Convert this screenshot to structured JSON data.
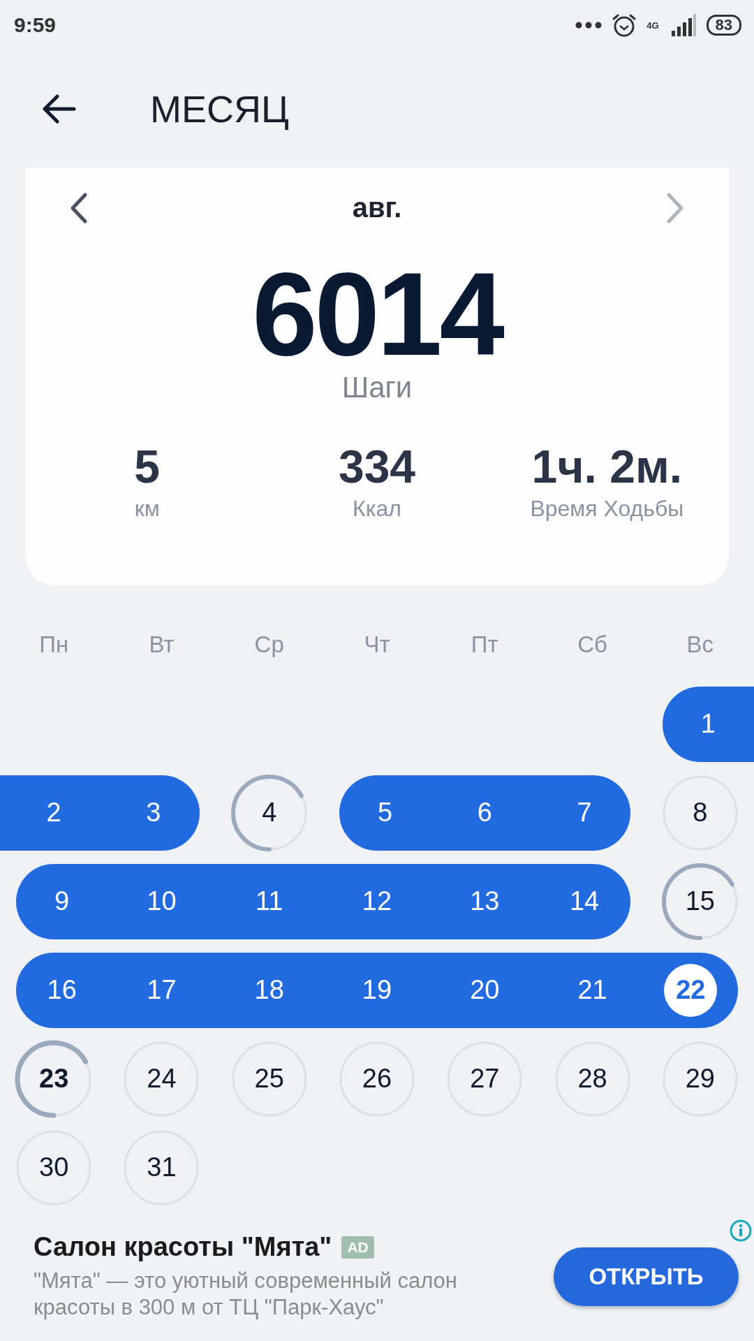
{
  "status_bar": {
    "time": "9:59",
    "network": "4G",
    "battery": "83"
  },
  "header": {
    "title": "МЕСЯЦ"
  },
  "summary": {
    "month": "авг.",
    "steps": "6014",
    "steps_label": "Шаги",
    "stats": [
      {
        "value": "5",
        "label": "км"
      },
      {
        "value": "334",
        "label": "Ккал"
      },
      {
        "value": "1ч. 2м.",
        "label": "Время Ходьбы"
      }
    ]
  },
  "calendar": {
    "weekdays": [
      "Пн",
      "Вт",
      "Ср",
      "Чт",
      "Пт",
      "Сб",
      "Вс"
    ],
    "weeks": [
      [
        {
          "day": "1",
          "kind": "goal",
          "selected": false,
          "today": false
        }
      ],
      [
        {
          "day": "2",
          "kind": "goal",
          "selected": false,
          "today": false
        },
        {
          "day": "3",
          "kind": "goal",
          "selected": false,
          "today": false
        },
        {
          "day": "4",
          "kind": "partial",
          "selected": false,
          "today": false
        },
        {
          "day": "5",
          "kind": "goal",
          "selected": false,
          "today": false
        },
        {
          "day": "6",
          "kind": "goal",
          "selected": false,
          "today": false
        },
        {
          "day": "7",
          "kind": "goal",
          "selected": false,
          "today": false
        },
        {
          "day": "8",
          "kind": "empty",
          "selected": false,
          "today": false
        }
      ],
      [
        {
          "day": "9",
          "kind": "goal",
          "selected": false,
          "today": false
        },
        {
          "day": "10",
          "kind": "goal",
          "selected": false,
          "today": false
        },
        {
          "day": "11",
          "kind": "goal",
          "selected": false,
          "today": false
        },
        {
          "day": "12",
          "kind": "goal",
          "selected": false,
          "today": false
        },
        {
          "day": "13",
          "kind": "goal",
          "selected": false,
          "today": false
        },
        {
          "day": "14",
          "kind": "goal",
          "selected": false,
          "today": false
        },
        {
          "day": "15",
          "kind": "partial",
          "selected": false,
          "today": false
        }
      ],
      [
        {
          "day": "16",
          "kind": "goal",
          "selected": false,
          "today": false
        },
        {
          "day": "17",
          "kind": "goal",
          "selected": false,
          "today": false
        },
        {
          "day": "18",
          "kind": "goal",
          "selected": false,
          "today": false
        },
        {
          "day": "19",
          "kind": "goal",
          "selected": false,
          "today": false
        },
        {
          "day": "20",
          "kind": "goal",
          "selected": false,
          "today": false
        },
        {
          "day": "21",
          "kind": "goal",
          "selected": false,
          "today": false
        },
        {
          "day": "22",
          "kind": "goal",
          "selected": true,
          "today": false
        }
      ],
      [
        {
          "day": "23",
          "kind": "partial",
          "selected": false,
          "today": true
        },
        {
          "day": "24",
          "kind": "empty",
          "selected": false,
          "today": false
        },
        {
          "day": "25",
          "kind": "empty",
          "selected": false,
          "today": false
        },
        {
          "day": "26",
          "kind": "empty",
          "selected": false,
          "today": false
        },
        {
          "day": "27",
          "kind": "empty",
          "selected": false,
          "today": false
        },
        {
          "day": "28",
          "kind": "empty",
          "selected": false,
          "today": false
        },
        {
          "day": "29",
          "kind": "empty",
          "selected": false,
          "today": false
        }
      ],
      [
        {
          "day": "30",
          "kind": "empty",
          "selected": false,
          "today": false
        },
        {
          "day": "31",
          "kind": "empty",
          "selected": false,
          "today": false
        }
      ]
    ]
  },
  "ad": {
    "title": "Салон красоты \"Мята\"",
    "badge": "AD",
    "description": "\"Мята\" — это уютный современный салон красоты в 300 м от ТЦ \"Парк-Хаус\"",
    "button": "ОТКРЫТЬ"
  }
}
